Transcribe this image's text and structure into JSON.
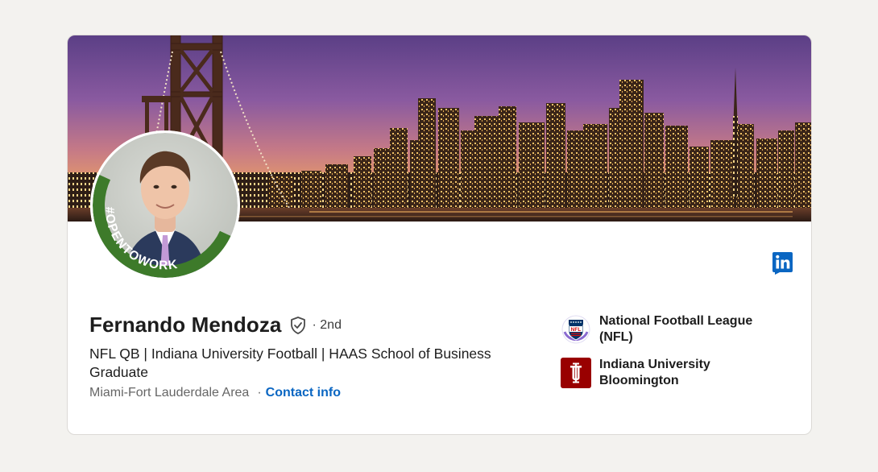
{
  "profile": {
    "name": "Fernando Mendoza",
    "degree": "· 2nd",
    "headline": "NFL QB | Indiana University Football | HAAS School of Business Graduate",
    "location": "Miami-Fort Lauderdale Area",
    "separator": "·",
    "contact_label": "Contact info",
    "frame_text": "#OPENTOWORK"
  },
  "organizations": [
    {
      "name": "National Football League\n(NFL)",
      "logo": "nfl-logo"
    },
    {
      "name": "Indiana University\nBloomington",
      "logo": "indiana-university-logo"
    }
  ],
  "icons": {
    "verified": "verified-shield-icon",
    "linkedin": "linkedin-icon"
  },
  "colors": {
    "link": "#0a66c2",
    "open_to_work_green": "#3d7a2a",
    "indiana_crimson": "#990000",
    "linkedin_blue": "#0a66c2"
  }
}
